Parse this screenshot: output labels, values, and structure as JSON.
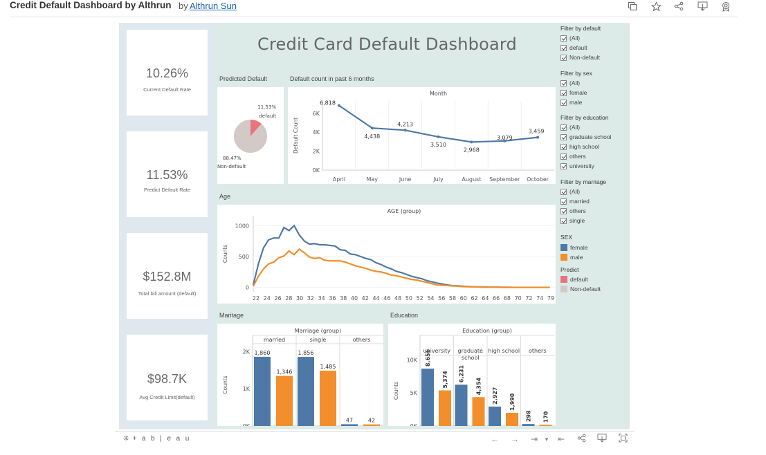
{
  "header": {
    "title": "Credit Default Dashboard by Althrun",
    "by": "by",
    "author": "Althrun Sun",
    "icons": [
      "copy-icon",
      "star-icon",
      "share-icon",
      "download-icon",
      "badge-icon"
    ]
  },
  "dashboard": {
    "title": "Credit Card Default Dashboard",
    "kpis": [
      {
        "value": "10.26%",
        "label": "Current Default Rate"
      },
      {
        "value": "11.53%",
        "label": "Predict Default Rate"
      },
      {
        "value": "$152.8M",
        "label": "Total bill amount (default)"
      },
      {
        "value": "$98.7K",
        "label": "Avg Credit Limit(default)"
      }
    ],
    "sections": {
      "predicted": "Predicted Default",
      "count6": "Default count in past 6 months",
      "age": "Age",
      "maritage": "Maritage",
      "education": "Education"
    }
  },
  "filters": {
    "default": {
      "title": "Filter by  default",
      "items": [
        "(All)",
        "default",
        "Non-default"
      ]
    },
    "sex": {
      "title": "Filter by sex",
      "items": [
        "(All)",
        "female",
        "male"
      ]
    },
    "education": {
      "title": "Filter by education",
      "items": [
        "(All)",
        "graduate school",
        "high school",
        "others",
        "university"
      ]
    },
    "marriage": {
      "title": "Filter by marriage",
      "items": [
        "(All)",
        "married",
        "others",
        "single"
      ]
    }
  },
  "legends": {
    "sex": {
      "title": "SEX",
      "items": [
        {
          "label": "female",
          "color": "#4e79a7"
        },
        {
          "label": "male",
          "color": "#f28e2b"
        }
      ]
    },
    "predict": {
      "title": "Predict",
      "items": [
        {
          "label": "default",
          "color": "#e8747c"
        },
        {
          "label": "Non-default",
          "color": "#d3c9c7"
        }
      ]
    }
  },
  "toolbar": {
    "logo": "+ a b | e a u"
  },
  "chart_data": [
    {
      "id": "pie",
      "type": "pie",
      "slices": [
        {
          "label": "default",
          "value": 11.53,
          "text": "11.53%",
          "color": "#e8747c"
        },
        {
          "label": "Non-default",
          "value": 88.47,
          "text": "88.47%",
          "color": "#d3c9c7"
        }
      ]
    },
    {
      "id": "month",
      "type": "line",
      "title": "Month",
      "ylabel": "Default Count",
      "categories": [
        "April",
        "May",
        "June",
        "July",
        "August",
        "September",
        "October"
      ],
      "values": [
        6818,
        4438,
        4213,
        3510,
        2968,
        3079,
        3459
      ],
      "value_labels": [
        "6,818",
        "4,438",
        "4,213",
        "3,510",
        "2,968",
        "3,079",
        "3,459"
      ],
      "yticks": [
        "0K",
        "2K",
        "4K",
        "6K"
      ],
      "ylim": [
        0,
        7300
      ],
      "color": "#4e79a7"
    },
    {
      "id": "age",
      "type": "line",
      "title": "AGE (group)",
      "ylabel": "Counts",
      "yticks": [
        0,
        500,
        1000
      ],
      "ylim": [
        -70,
        1160
      ],
      "xticks": [
        22,
        24,
        26,
        28,
        30,
        32,
        34,
        36,
        38,
        40,
        42,
        44,
        46,
        48,
        50,
        52,
        54,
        56,
        58,
        60,
        62,
        64,
        66,
        68,
        70,
        72,
        74,
        79
      ],
      "x": [
        21,
        22,
        23,
        24,
        25,
        26,
        27,
        28,
        29,
        30,
        31,
        32,
        33,
        34,
        35,
        36,
        37,
        38,
        39,
        40,
        41,
        42,
        43,
        44,
        45,
        46,
        47,
        48,
        49,
        50,
        51,
        52,
        53,
        54,
        55,
        56,
        57,
        58,
        59,
        60,
        61,
        62,
        63,
        64,
        65,
        66,
        67,
        68,
        69,
        70,
        71,
        72,
        73,
        74,
        75,
        79
      ],
      "series": [
        {
          "name": "female",
          "color": "#4e79a7",
          "values": [
            40,
            380,
            640,
            770,
            800,
            800,
            970,
            920,
            1000,
            850,
            750,
            700,
            710,
            690,
            690,
            680,
            670,
            610,
            600,
            540,
            530,
            500,
            470,
            450,
            400,
            370,
            330,
            300,
            260,
            240,
            210,
            180,
            160,
            140,
            110,
            90,
            70,
            55,
            40,
            30,
            25,
            20,
            15,
            12,
            10,
            8,
            6,
            5,
            4,
            3,
            3,
            2,
            2,
            2,
            2,
            2
          ]
        },
        {
          "name": "male",
          "color": "#f28e2b",
          "values": [
            20,
            180,
            300,
            380,
            410,
            480,
            510,
            590,
            530,
            620,
            560,
            490,
            470,
            480,
            440,
            430,
            430,
            430,
            410,
            380,
            350,
            330,
            310,
            280,
            260,
            250,
            230,
            200,
            190,
            170,
            150,
            130,
            120,
            100,
            80,
            60,
            40,
            35,
            30,
            25,
            20,
            15,
            12,
            10,
            8,
            6,
            5,
            5,
            4,
            3,
            3,
            2,
            2,
            2,
            2,
            2
          ]
        }
      ]
    },
    {
      "id": "marriage",
      "type": "bar",
      "title": "Marriage (group)",
      "ylabel": "Counts",
      "categories": [
        "married",
        "single",
        "others"
      ],
      "yticks": [
        "0K",
        "1K",
        "2K"
      ],
      "ylim": [
        0,
        2100
      ],
      "series": [
        {
          "name": "female",
          "color": "#4e79a7",
          "values": [
            1860,
            1856,
            47
          ],
          "labels": [
            "1,860",
            "1,856",
            "47"
          ]
        },
        {
          "name": "male",
          "color": "#f28e2b",
          "values": [
            1346,
            1485,
            42
          ],
          "labels": [
            "1,346",
            "1,485",
            "42"
          ]
        }
      ]
    },
    {
      "id": "education",
      "type": "bar",
      "title": "Education (group)",
      "ylabel": "Counts",
      "categories": [
        "university",
        "graduate school",
        "high school",
        "others"
      ],
      "yticks": [
        "0K",
        "5K",
        "10K"
      ],
      "ylim": [
        0,
        11700
      ],
      "series": [
        {
          "name": "female",
          "color": "#4e79a7",
          "values": [
            8656,
            6231,
            2927,
            298
          ],
          "labels": [
            "8,656",
            "6,231",
            "2,927",
            "298"
          ]
        },
        {
          "name": "male",
          "color": "#f28e2b",
          "values": [
            5374,
            4354,
            1990,
            170
          ],
          "labels": [
            "5,374",
            "4,354",
            "1,990",
            "170"
          ]
        }
      ]
    }
  ]
}
